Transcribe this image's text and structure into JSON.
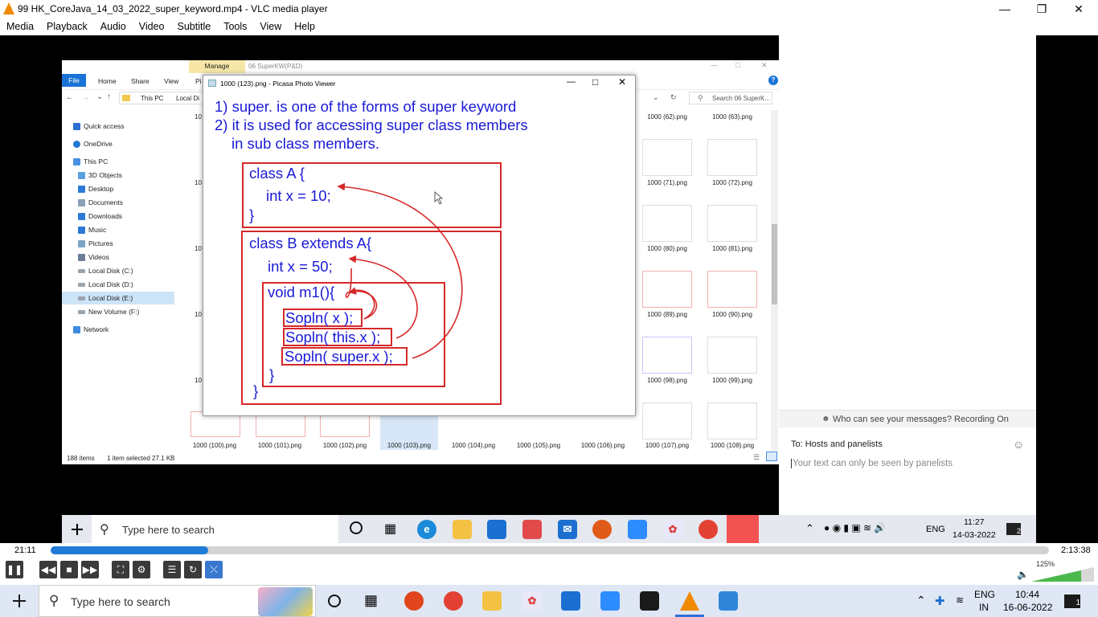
{
  "window": {
    "title": "99 HK_CoreJava_14_03_2022_super_keyword.mp4 - VLC media player"
  },
  "menu": [
    "Media",
    "Playback",
    "Audio",
    "Video",
    "Subtitle",
    "Tools",
    "View",
    "Help"
  ],
  "explorer": {
    "ribbon_tab_manage": "Manage",
    "folder_title": "06 SuperKW(P&D)",
    "tabs": [
      "File",
      "Home",
      "Share",
      "View",
      "Pi"
    ],
    "path": [
      "This PC",
      "Local Di"
    ],
    "search_placeholder": "Search 06 SuperK...",
    "nav": [
      "Quick access",
      "OneDrive",
      "This PC",
      "3D Objects",
      "Desktop",
      "Documents",
      "Downloads",
      "Music",
      "Pictures",
      "Videos",
      "Local Disk (C:)",
      "Local Disk (D:)",
      "Local Disk (E:)",
      "New Volume (F:)",
      "Network"
    ],
    "thumbs_right": [
      [
        "1000 (62).png",
        "1000 (63).png"
      ],
      [
        "1000 (71).png",
        "1000 (72).png"
      ],
      [
        "1000 (80).png",
        "1000 (81).png"
      ],
      [
        "1000 (89).png",
        "1000 (90).png"
      ],
      [
        "1000 (98).png",
        "1000 (99).png"
      ]
    ],
    "bottom_row": [
      "1000 (100).png",
      "1000 (101).png",
      "1000 (102).png",
      "1000 (103).png",
      "1000 (104).png",
      "1000 (105).png",
      "1000 (106).png",
      "1000 (107).png",
      "1000 (108).png"
    ],
    "status_items": "188 items",
    "status_selected": "1 item selected  27.1 KB",
    "left_partial": [
      "10",
      "10",
      "10",
      "10",
      "10",
      "10",
      "10"
    ]
  },
  "picasa": {
    "title": "1000 (123).png - Picasa Photo Viewer",
    "line1": "1) super. is one of the forms of super keyword",
    "line2": "2) it is used for accessing super class members",
    "line3": "in sub class members.",
    "classA": "class A {",
    "intx10": "int x = 10;",
    "brace": "}",
    "classB": "class B extends A{",
    "intx50": "int x = 50;",
    "voidm1": "void m1(){",
    "sop1": "Sopln( x );",
    "sop2": "Sopln( this.x );",
    "sop3": "Sopln( super.x );",
    "brace2": "}",
    "brace3": "}"
  },
  "chat": {
    "visibility": "Who can see your messages? Recording On",
    "to": "To:  Hosts and panelists",
    "placeholder": "Your text can only be seen by panelists"
  },
  "inner_taskbar": {
    "search": "Type here to search",
    "lang": "ENG",
    "time": "11:27",
    "date": "14-03-2022",
    "notif": "2"
  },
  "player": {
    "elapsed": "21:11",
    "total": "2:13:38",
    "progress": 0.158,
    "volume": "125%"
  },
  "taskbar": {
    "search": "Type here to search",
    "lang": "ENG",
    "region": "IN",
    "time": "10:44",
    "date": "16-06-2022",
    "notif": "1"
  },
  "colors": {
    "vlc_orange": "#f08a00",
    "seek_blue": "#1f7bd6",
    "code_blue": "#1a1ad6",
    "code_red": "#d62828"
  }
}
